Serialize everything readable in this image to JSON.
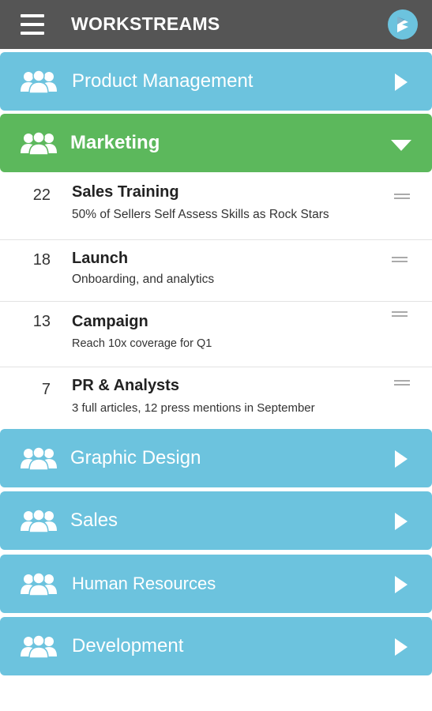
{
  "header": {
    "title": "WORKSTREAMS"
  },
  "colors": {
    "appbar": "#555555",
    "group_blue": "#6cc3de",
    "group_green": "#5cb85c"
  },
  "icons": {
    "menu": "hamburger-icon",
    "logo": "app-logo-icon",
    "group": "people-group-icon",
    "collapsed": "chevron-right-icon",
    "expanded": "chevron-down-icon",
    "drag": "drag-handle-icon"
  },
  "groups_before": [
    {
      "label": "Product Management"
    }
  ],
  "expanded_group": {
    "label": "Marketing",
    "items": [
      {
        "count": "22",
        "title": "Sales Training",
        "subtitle": "50% of Sellers Self Assess Skills as Rock Stars"
      },
      {
        "count": "18",
        "title": "Launch",
        "subtitle": "Onboarding, and analytics"
      },
      {
        "count": "13",
        "title": "Campaign",
        "subtitle": "Reach 10x coverage for Q1"
      },
      {
        "count": "7",
        "title": "PR & Analysts",
        "subtitle": "3 full articles, 12 press mentions in September"
      }
    ]
  },
  "groups_after": [
    {
      "label": "Graphic Design"
    },
    {
      "label": "Sales"
    },
    {
      "label": "Human Resources"
    },
    {
      "label": "Development"
    }
  ]
}
